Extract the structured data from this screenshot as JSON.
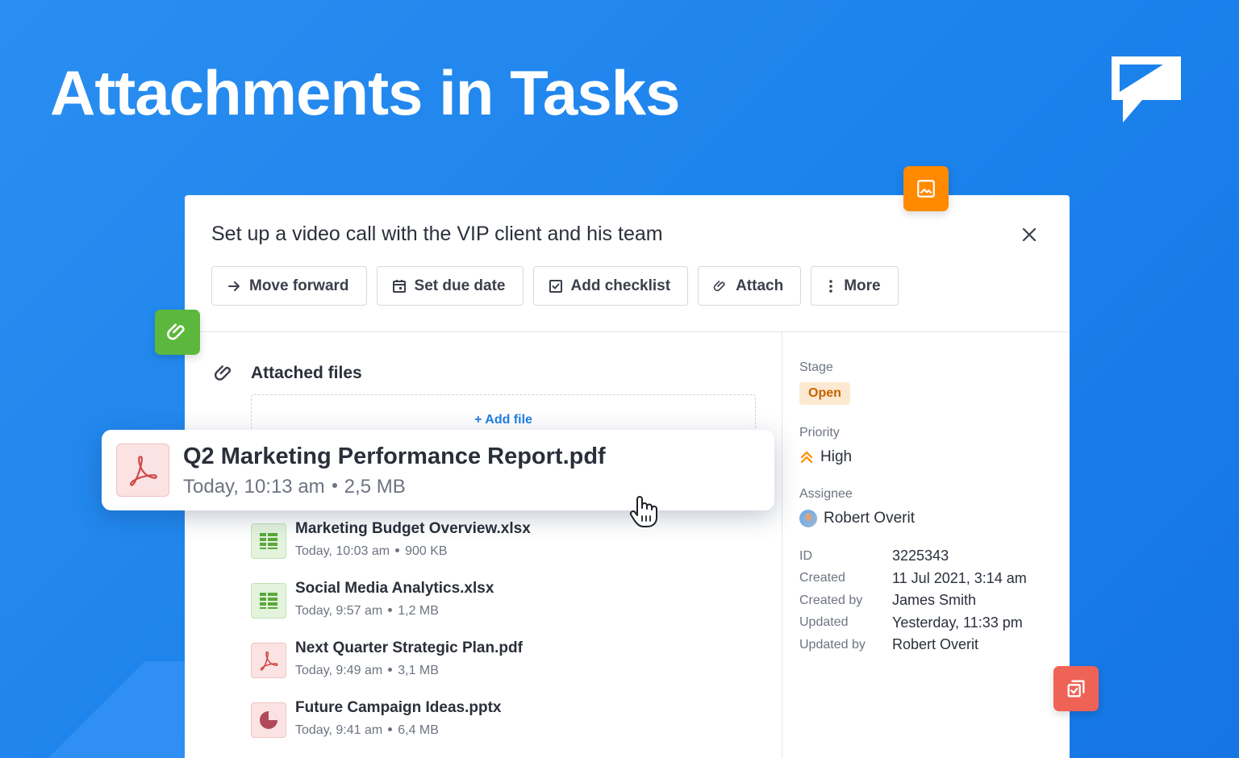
{
  "hero": {
    "title": "Attachments in Tasks"
  },
  "task": {
    "title": "Set up a video call with the VIP client and his team",
    "toolbar": [
      {
        "label": "Move forward",
        "icon": "arrow-right-icon"
      },
      {
        "label": "Set due date",
        "icon": "calendar-icon"
      },
      {
        "label": "Add checklist",
        "icon": "checkbox-icon"
      },
      {
        "label": "Attach",
        "icon": "paperclip-icon"
      },
      {
        "label": "More",
        "icon": "more-vertical-icon"
      }
    ]
  },
  "attachments": {
    "section_title": "Attached files",
    "add_file_label": "+ Add file",
    "highlighted": {
      "name": "Q2 Marketing Performance Report.pdf",
      "time": "Today, 10:13 am",
      "size": "2,5 MB",
      "type": "pdf"
    },
    "files": [
      {
        "name": "Marketing Budget Overview.xlsx",
        "time": "Today, 10:03 am",
        "size": "900 KB",
        "type": "xlsx"
      },
      {
        "name": "Social Media Analytics.xlsx",
        "time": "Today, 9:57 am",
        "size": "1,2 MB",
        "type": "xlsx"
      },
      {
        "name": "Next Quarter Strategic Plan.pdf",
        "time": "Today, 9:49 am",
        "size": "3,1 MB",
        "type": "pdf"
      },
      {
        "name": "Future Campaign Ideas.pptx",
        "time": "Today, 9:41 am",
        "size": "6,4 MB",
        "type": "pptx"
      }
    ]
  },
  "details": {
    "stage_label": "Stage",
    "stage_value": "Open",
    "priority_label": "Priority",
    "priority_value": "High",
    "assignee_label": "Assignee",
    "assignee_value": "Robert Overit",
    "meta": [
      {
        "key": "ID",
        "value": "3225343"
      },
      {
        "key": "Created",
        "value": "11 Jul 2021, 3:14 am"
      },
      {
        "key": "Created by",
        "value": "James Smith"
      },
      {
        "key": "Updated",
        "value": "Yesterday, 11:33 pm"
      },
      {
        "key": "Updated by",
        "value": "Robert Overit"
      }
    ]
  },
  "colors": {
    "background": "#1b82ec",
    "accent_blue": "#1f7fe3",
    "orange": "#ff8a00",
    "green": "#5cb83c",
    "red": "#ef6256",
    "stage_badge_bg": "#fde9d1",
    "stage_badge_text": "#c26200"
  }
}
